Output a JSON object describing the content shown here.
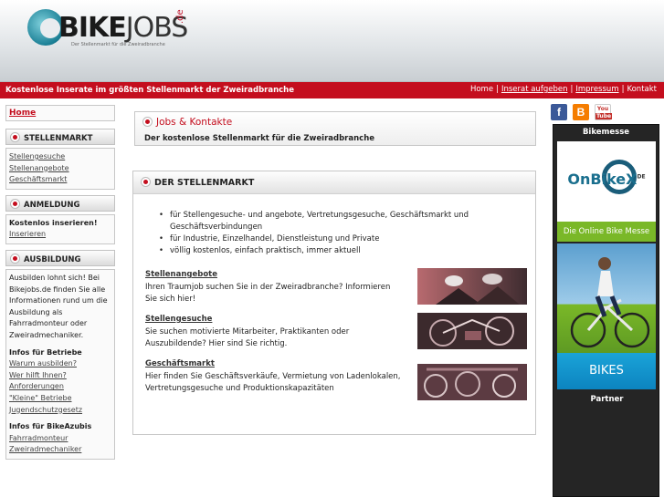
{
  "header": {
    "logo_word": "BIKE",
    "logo_word2": "JOBS",
    "logo_tld": ".de",
    "logo_tagline": "Der Stellenmarkt für die Zweiradbranche"
  },
  "topbar": {
    "slogan": "Kostenlose Inserate im größten Stellenmarkt der Zweiradbranche",
    "links": [
      "Home",
      "Inserat aufgeben",
      "Impressum",
      "Kontakt"
    ]
  },
  "sidebar": {
    "home": "Home",
    "stellenmarkt": {
      "title": "STELLENMARKT",
      "items": [
        "Stellengesuche",
        "Stellenangebote",
        "Geschäftsmarkt"
      ]
    },
    "anmeldung": {
      "title": "ANMELDUNG",
      "bold": "Kostenlos inserieren!",
      "items": [
        "Inserieren"
      ]
    },
    "ausbildung": {
      "title": "AUSBILDUNG",
      "text": "Ausbilden lohnt sich! Bei Bikejobs.de finden Sie alle Informationen rund um die Ausbildung als Fahrradmonteur oder Zweiradmechaniker.",
      "betriebe_title": "Infos für Betriebe",
      "betriebe_items": [
        "Warum ausbilden?",
        "Wer hilft Ihnen?",
        "Anforderungen",
        "\"Kleine\" Betriebe",
        "Jugendschutzgesetz"
      ],
      "azubis_title": "Infos für BikeAzubis",
      "azubis_items": [
        "Fahrradmonteur",
        "Zweiradmechaniker"
      ]
    }
  },
  "main": {
    "jobs_title": "Jobs & Kontakte",
    "jobs_subtitle": "Der kostenlose Stellenmarkt für die Zweiradbranche",
    "markt_title": "DER STELLENMARKT",
    "bullets": [
      "für Stellengesuche- und angebote, Vertretungsgesuche, Geschäftsmarkt und Geschäftsverbindungen",
      "für Industrie, Einzelhandel, Dienstleistung und Private",
      "völlig kostenlos, einfach praktisch, immer aktuell"
    ],
    "sections": [
      {
        "link": "Stellenangebote",
        "text": "Ihren Traumjob suchen Sie in der Zweiradbranche? Informieren Sie sich hier!"
      },
      {
        "link": "Stellengesuche",
        "text": "Sie suchen motivierte Mitarbeiter, Praktikanten oder Auszubildende? Hier sind Sie richtig."
      },
      {
        "link": "Geschäftsmarkt",
        "text": "Hier finden Sie Geschäftsverkäufe, Vermietung von Ladenlokalen, Vertretungsgesuche und Produktionskapazitäten"
      }
    ]
  },
  "right": {
    "social_icons": [
      "facebook-icon",
      "blogger-icon",
      "youtube-icon"
    ],
    "bikemesse": "Bikemesse",
    "onbike_name1": "OnBike",
    "onbike_name2": "X",
    "onbike_de": "DE",
    "onbike_sub": "Die Online Bike Messe",
    "bikes": "BIKES",
    "partner": "Partner"
  },
  "colors": {
    "brand_red": "#c40e1e",
    "brand_green": "#7ab828",
    "brand_blue": "#1aa3d8"
  }
}
